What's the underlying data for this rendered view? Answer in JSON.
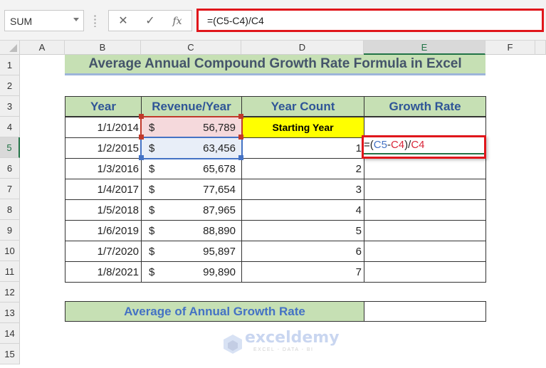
{
  "toolbar": {
    "name_box": "SUM",
    "cancel_icon": "✕",
    "enter_icon": "✓",
    "insert_function_label": "fx",
    "formula": "=(C5-C4)/C4"
  },
  "columns": [
    "A",
    "B",
    "C",
    "D",
    "E",
    "F"
  ],
  "selected_column": "E",
  "rows": [
    "1",
    "2",
    "3",
    "4",
    "5",
    "6",
    "7",
    "8",
    "9",
    "10",
    "11",
    "12",
    "13",
    "14",
    "15"
  ],
  "selected_row": "5",
  "sheet": {
    "title": "Average Annual Compound Growth Rate Formula in Excel",
    "headers": [
      "Year",
      "Revenue/Year",
      "Year Count",
      "Growth Rate"
    ],
    "currency_symbol": "$",
    "data": [
      {
        "year": "1/1/2014",
        "revenue": "56,789",
        "count": "Starting Year",
        "growth": ""
      },
      {
        "year": "1/2/2015",
        "revenue": "63,456",
        "count": "1",
        "growth": ""
      },
      {
        "year": "1/3/2016",
        "revenue": "65,678",
        "count": "2",
        "growth": ""
      },
      {
        "year": "1/4/2017",
        "revenue": "77,654",
        "count": "3",
        "growth": ""
      },
      {
        "year": "1/5/2018",
        "revenue": "87,965",
        "count": "4",
        "growth": ""
      },
      {
        "year": "1/6/2019",
        "revenue": "88,890",
        "count": "5",
        "growth": ""
      },
      {
        "year": "1/7/2020",
        "revenue": "95,897",
        "count": "6",
        "growth": ""
      },
      {
        "year": "1/8/2021",
        "revenue": "99,890",
        "count": "7",
        "growth": ""
      }
    ],
    "editing_formula_parts": [
      "=(",
      "C5",
      "-",
      "C4",
      ")/",
      "C4"
    ],
    "average_label": "Average of Annual Growth Rate",
    "average_value": ""
  },
  "watermark": {
    "name": "exceldemy",
    "tagline": "EXCEL - DATA - BI"
  },
  "colors": {
    "highlight_red": "#e0161b",
    "header_green": "#c6e0b4",
    "header_text_blue": "#2f5597",
    "excel_green": "#217346",
    "yellow": "#ffff00"
  }
}
